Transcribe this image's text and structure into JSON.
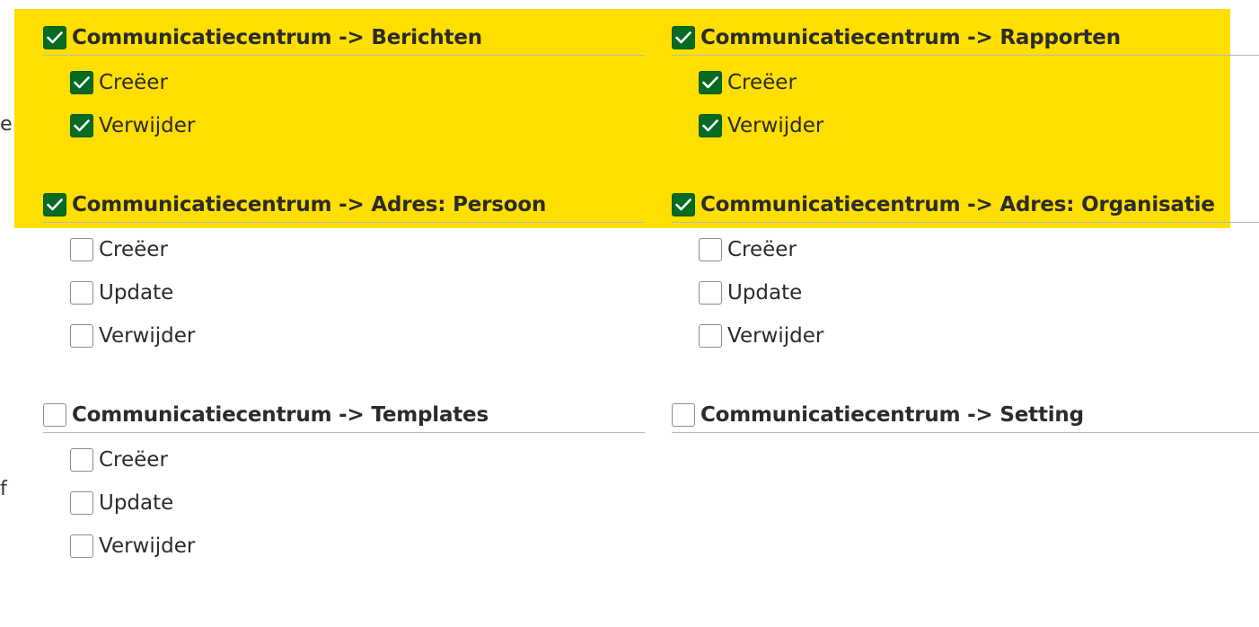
{
  "edge_fragments": [
    "e",
    "f"
  ],
  "groups": [
    {
      "title": "Communicatiecentrum -> Berichten",
      "checked": true,
      "items": [
        {
          "label": "Creëer",
          "checked": true
        },
        {
          "label": "Verwijder",
          "checked": true
        }
      ]
    },
    {
      "title": "Communicatiecentrum -> Rapporten",
      "checked": true,
      "items": [
        {
          "label": "Creëer",
          "checked": true
        },
        {
          "label": "Verwijder",
          "checked": true
        }
      ]
    },
    {
      "title": "Communicatiecentrum -> Adres: Persoon",
      "checked": true,
      "items": [
        {
          "label": "Creëer",
          "checked": false
        },
        {
          "label": "Update",
          "checked": false
        },
        {
          "label": "Verwijder",
          "checked": false
        }
      ]
    },
    {
      "title": "Communicatiecentrum -> Adres: Organisatie",
      "checked": true,
      "items": [
        {
          "label": "Creëer",
          "checked": false
        },
        {
          "label": "Update",
          "checked": false
        },
        {
          "label": "Verwijder",
          "checked": false
        }
      ]
    },
    {
      "title": "Communicatiecentrum -> Templates",
      "checked": false,
      "items": [
        {
          "label": "Creëer",
          "checked": false
        },
        {
          "label": "Update",
          "checked": false
        },
        {
          "label": "Verwijder",
          "checked": false
        }
      ]
    },
    {
      "title": "Communicatiecentrum -> Setting",
      "checked": false,
      "items": []
    }
  ],
  "colors": {
    "highlight": "#fedf00",
    "checkbox_checked": "#076b22",
    "divider": "#b9b9b9"
  }
}
